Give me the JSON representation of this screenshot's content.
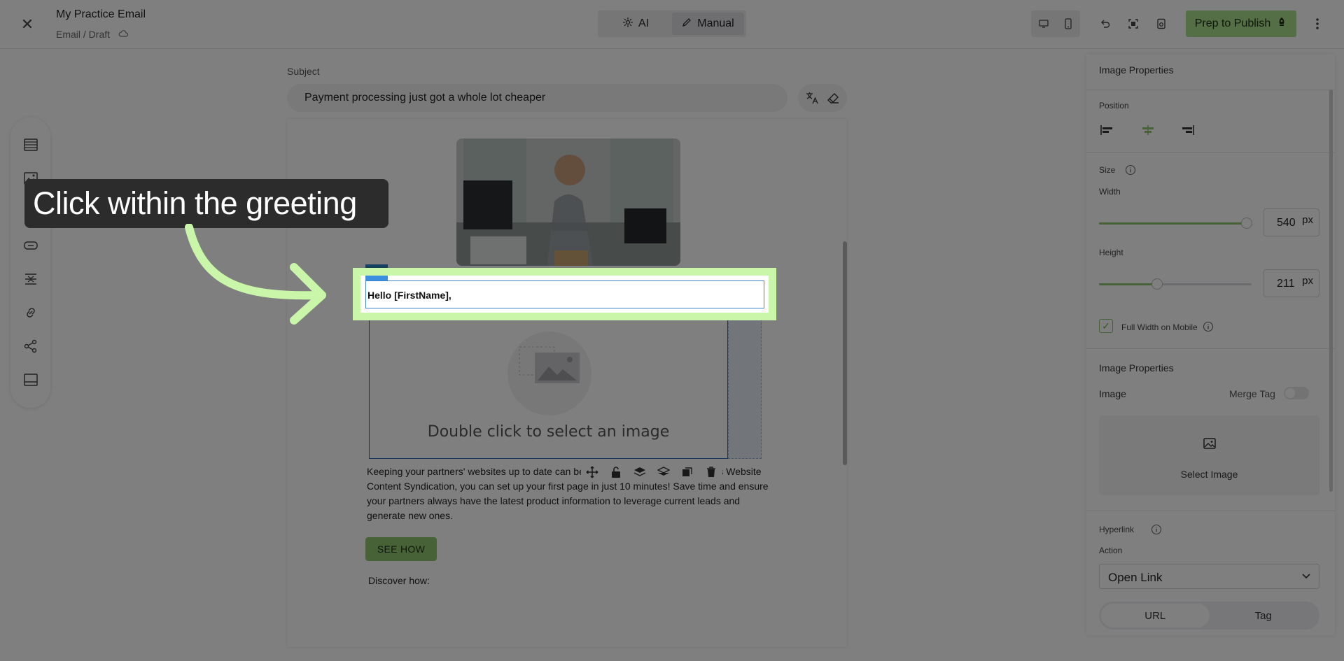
{
  "header": {
    "title": "My Practice Email",
    "breadcrumb": "Email / Draft",
    "modes": [
      "AI",
      "Manual"
    ],
    "publish_label": "Prep to Publish"
  },
  "subject": {
    "label": "Subject",
    "value": "Payment processing just got a whole lot cheaper"
  },
  "canvas": {
    "greeting": "Hello [FirstName],",
    "image_placeholder": "Double click to select an image",
    "body": "Keeping your partners' websites up to date can be a hassle. With StructuredWeb's Website Content Syndication, you can set up your first page in just 10 minutes! Save time and ensure your partners always have the latest product information to leverage current leads and generate new ones.",
    "cta": "SEE HOW",
    "discover": "Discover how:"
  },
  "panel": {
    "title": "Image Properties",
    "position_label": "Position",
    "size_label": "Size",
    "width_label": "Width",
    "width_value": "540",
    "width_fraction": 0.97,
    "height_label": "Height",
    "height_value": "211",
    "height_fraction": 0.38,
    "unit": "px",
    "full_width_mobile": "Full Width on Mobile",
    "image_props_title": "Image Properties",
    "image_label": "Image",
    "merge_tag_label": "Merge Tag",
    "select_image": "Select Image",
    "hyperlink_label": "Hyperlink",
    "action_label": "Action",
    "action_value": "Open Link",
    "link_tabs": [
      "URL",
      "Tag"
    ]
  },
  "tutorial": {
    "callout": "Click within the greeting"
  },
  "colors": {
    "accent_green": "#a9dc8a",
    "selection_blue": "#3d84c9",
    "highlight": "#c9f6a8"
  }
}
